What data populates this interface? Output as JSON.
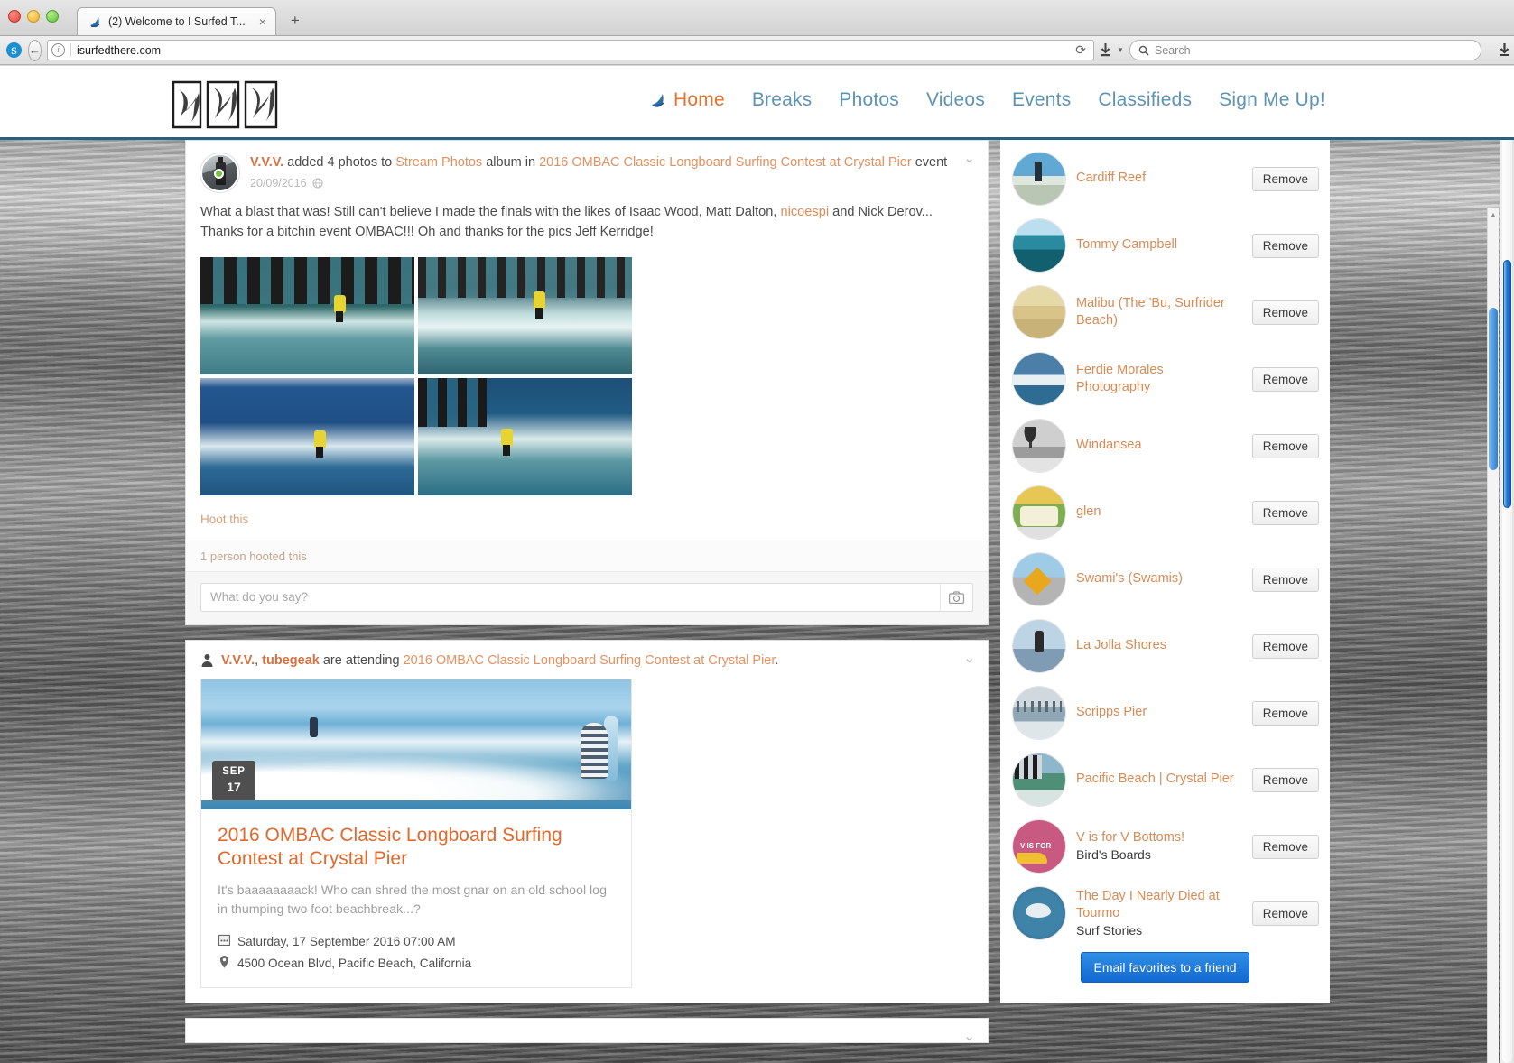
{
  "browser": {
    "tab": {
      "title": "(2) Welcome to I Surfed T...",
      "favicon_name": "surf-favicon",
      "close_label": "×"
    },
    "new_tab_label": "+",
    "url": "isurfedthere.com",
    "reload_label": "⟳",
    "search_placeholder": "Search",
    "toolbar_icons": [
      "download-icon",
      "home-icon",
      "bookmark-star-icon",
      "reading-list-icon",
      "shield-icon",
      "paper-plane-icon",
      "skype-icon",
      "youtube-icon",
      "feather-icon",
      "bookcase-icon",
      "library-icon",
      "lock-icon"
    ],
    "badge_count": "0",
    "menu_label": "☰"
  },
  "site": {
    "logo_alt": "IST logo",
    "nav": [
      {
        "label": "Home",
        "active": true,
        "icon": "surf-icon"
      },
      {
        "label": "Breaks",
        "active": false
      },
      {
        "label": "Photos",
        "active": false
      },
      {
        "label": "Videos",
        "active": false
      },
      {
        "label": "Events",
        "active": false
      },
      {
        "label": "Classifieds",
        "active": false
      },
      {
        "label": "Sign Me Up!",
        "active": false
      }
    ],
    "accent_orange": "#e8732e",
    "nav_blue": "#5d93b5",
    "header_border": "#2b5f80"
  },
  "feed": {
    "post1": {
      "author": "V.V.V.",
      "action_1": " added 4 photos to ",
      "album_link": "Stream Photos",
      "action_2": " album in ",
      "event_link": "2016 OMBAC Classic Longboard Surfing Contest at Crystal Pier",
      "action_3": " event",
      "timestamp": "20/09/2016",
      "privacy_icon": "globe-icon",
      "text_part_1": "What a blast that was! Still can't believe I made the finals with the likes of Isaac Wood, Matt Dalton, ",
      "mention": "nicoespi",
      "text_part_2": " and Nick Derov... Thanks for a bitchin event OMBAC!!! Oh and thanks for the pics Jeff Kerridge!",
      "photos": [
        "surfer-under-pier-yellow-jersey",
        "surfer-pier-pilings-turning",
        "surfer-blue-ocean-whitewater",
        "surfer-pier-arms-up"
      ],
      "hoot_label": "Hoot this",
      "hooted_count_label": "1 person hooted this",
      "comment_placeholder": "What do you say?",
      "camera_icon": "camera-icon",
      "collapse_icon": "chevron-down-icon"
    },
    "post2": {
      "attend_icon": "person-icon",
      "author_1": "V.V.V.",
      "separator": ", ",
      "author_2": "tubegeak",
      "action": " are attending ",
      "event_link": "2016 OMBAC Classic Longboard Surfing Contest at Crystal Pier",
      "period": ".",
      "collapse_icon": "chevron-down-icon",
      "event": {
        "badge_month": "SEP",
        "badge_day": "17",
        "title": "2016 OMBAC Classic Longboard Surfing Contest at Crystal Pier",
        "description": "It's baaaaaaaack! Who can shred the most gnar on an old school log in thumping two foot beachbreak...?",
        "date_icon": "calendar-icon",
        "date": "Saturday, 17 September 2016 07:00 AM",
        "location_icon": "map-pin-icon",
        "location": "4500 Ocean Blvd, Pacific Beach, California"
      }
    },
    "post3": {
      "collapse_icon": "chevron-down-icon"
    }
  },
  "sidebar": {
    "remove_label": "Remove",
    "email_button_label": "Email favorites to a friend",
    "favorites": [
      {
        "name": "Cardiff Reef",
        "sub": "",
        "thumb": "cardiff-reef-thumb"
      },
      {
        "name": "Tommy Campbell",
        "sub": "",
        "thumb": "tommy-campbell-thumb"
      },
      {
        "name": "Malibu (The 'Bu, Surfrider Beach)",
        "sub": "",
        "thumb": "malibu-thumb"
      },
      {
        "name": "Ferdie Morales Photography",
        "sub": "",
        "thumb": "ferdie-morales-thumb"
      },
      {
        "name": "Windansea",
        "sub": "",
        "thumb": "windansea-thumb"
      },
      {
        "name": "glen",
        "sub": "",
        "thumb": "glen-thumb"
      },
      {
        "name": "Swami's (Swamis)",
        "sub": "",
        "thumb": "swamis-thumb"
      },
      {
        "name": "La Jolla Shores",
        "sub": "",
        "thumb": "la-jolla-shores-thumb"
      },
      {
        "name": "Scripps Pier",
        "sub": "",
        "thumb": "scripps-pier-thumb"
      },
      {
        "name": "Pacific Beach | Crystal Pier",
        "sub": "",
        "thumb": "pacific-beach-thumb"
      },
      {
        "name": "V is for V Bottoms!",
        "sub": "Bird's Boards",
        "thumb": "v-bottoms-thumb"
      },
      {
        "name": "The Day I Nearly Died at Tourmo",
        "sub": "Surf Stories",
        "thumb": "tourmo-thumb"
      }
    ]
  }
}
